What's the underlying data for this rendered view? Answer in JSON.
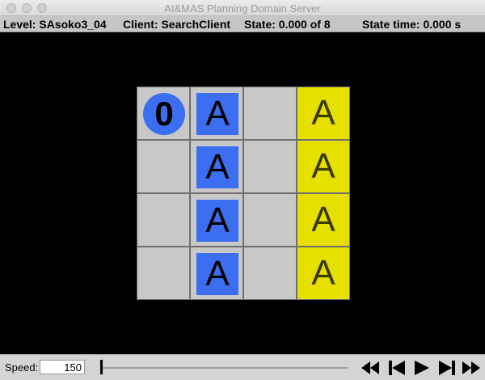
{
  "window": {
    "title": "AI&MAS Planning Domain Server"
  },
  "status": {
    "level": "Level: SAsoko3_04",
    "client": "Client: SearchClient",
    "state": "State: 0.000 of 8",
    "time": "State time: 0.000 s"
  },
  "level": {
    "rows": 4,
    "cols": 4,
    "agent": {
      "label": "0",
      "row": 0,
      "col": 0,
      "color": "#3b6ef0"
    },
    "boxes": [
      {
        "label": "A",
        "row": 0,
        "col": 1,
        "color": "#3b6ef0"
      },
      {
        "label": "A",
        "row": 1,
        "col": 1,
        "color": "#3b6ef0"
      },
      {
        "label": "A",
        "row": 2,
        "col": 1,
        "color": "#3b6ef0"
      },
      {
        "label": "A",
        "row": 3,
        "col": 1,
        "color": "#3b6ef0"
      }
    ],
    "goals": [
      {
        "label": "A",
        "row": 0,
        "col": 3,
        "color": "#e6df00"
      },
      {
        "label": "A",
        "row": 1,
        "col": 3,
        "color": "#e6df00"
      },
      {
        "label": "A",
        "row": 2,
        "col": 3,
        "color": "#e6df00"
      },
      {
        "label": "A",
        "row": 3,
        "col": 3,
        "color": "#e6df00"
      }
    ],
    "floor_color": "#c8c8c8"
  },
  "controls": {
    "speed_label": "Speed:",
    "speed_value": "150",
    "progress": 0,
    "buttons": [
      "rewind-icon",
      "step-back-icon",
      "play-icon",
      "step-forward-icon",
      "fast-forward-icon"
    ]
  }
}
